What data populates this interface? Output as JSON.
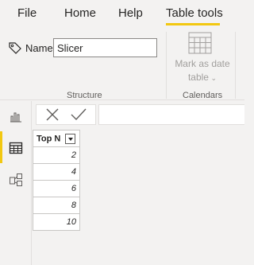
{
  "menu": {
    "file": "File",
    "home": "Home",
    "help": "Help",
    "table_tools": "Table tools"
  },
  "ribbon": {
    "name_label": "Name",
    "name_value": "Slicer",
    "structure_label": "Structure",
    "mark_as_date_line1": "Mark as date",
    "mark_as_date_line2": "table",
    "calendars_label": "Calendars"
  },
  "table": {
    "column_header": "Top N",
    "rows": [
      "2",
      "4",
      "6",
      "8",
      "10"
    ]
  },
  "colors": {
    "accent": "#f2c811",
    "ribbon_bg": "#f3f2f1",
    "disabled_text": "#a19f9d"
  },
  "icons": {
    "report_view": "bar-chart-icon",
    "data_view": "table-grid-icon",
    "model_view": "model-diagram-icon"
  }
}
